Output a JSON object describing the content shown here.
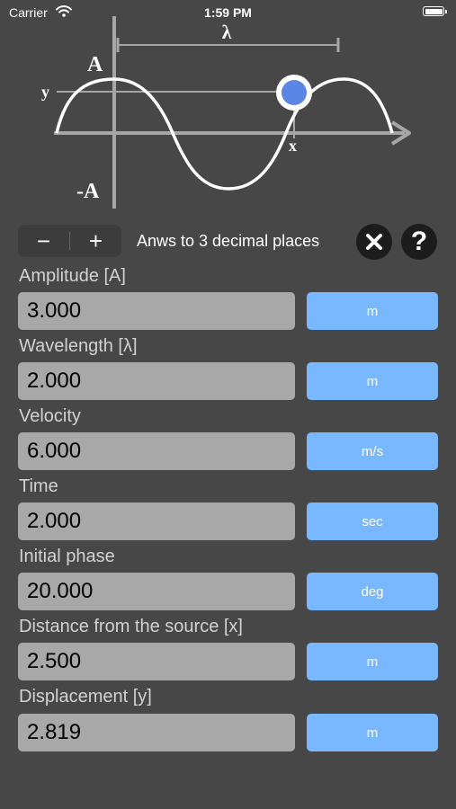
{
  "status_bar": {
    "carrier": "Carrier",
    "time": "1:59 PM"
  },
  "diagram": {
    "wavelength_symbol": "λ",
    "amplitude_top": "A",
    "amplitude_bottom": "-A",
    "y_marker": "y",
    "x_marker": "x",
    "point_color": "#5b86e5"
  },
  "controls": {
    "decrement_label": "−",
    "increment_label": "+",
    "precision_text": "Anws to 3 decimal places",
    "help_label": "?"
  },
  "fields": [
    {
      "label": "Amplitude [A]",
      "value": "3.000",
      "unit": "m"
    },
    {
      "label": "Wavelength [λ]",
      "value": "2.000",
      "unit": "m"
    },
    {
      "label": "Velocity",
      "value": "6.000",
      "unit": "m/s"
    },
    {
      "label": "Time",
      "value": "2.000",
      "unit": "sec"
    },
    {
      "label": "Initial phase",
      "value": "20.000",
      "unit": "deg"
    },
    {
      "label": "Distance from the source [x]",
      "value": "2.500",
      "unit": "m"
    },
    {
      "label": "Displacement [y]",
      "value": "2.819",
      "unit": "m"
    }
  ],
  "colors": {
    "background": "#474747",
    "field_bg": "#a8a8a8",
    "unit_button": "#79b7ff",
    "stepper_bg": "#3c3c3c"
  }
}
